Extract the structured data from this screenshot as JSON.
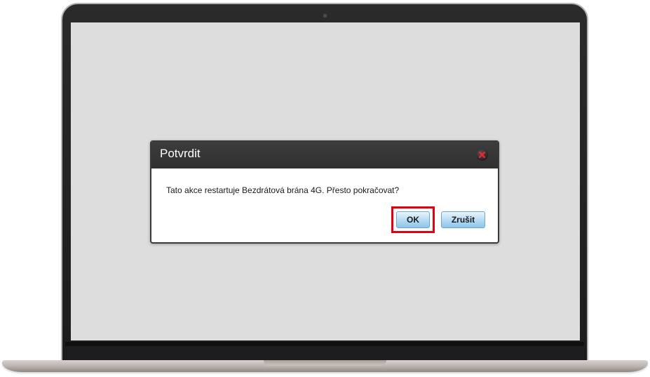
{
  "dialog": {
    "title": "Potvrdit",
    "message": "Tato akce restartuje Bezdrátová brána 4G. Přesto pokračovat?",
    "ok_label": "OK",
    "cancel_label": "Zrušit",
    "close_icon": "close-icon"
  },
  "colors": {
    "screen_background": "#dddddd",
    "dialog_header": "#333333",
    "button_gradient_top": "#e9f5fc",
    "button_gradient_bottom": "#8cc6ea",
    "highlight": "#e3000f"
  }
}
